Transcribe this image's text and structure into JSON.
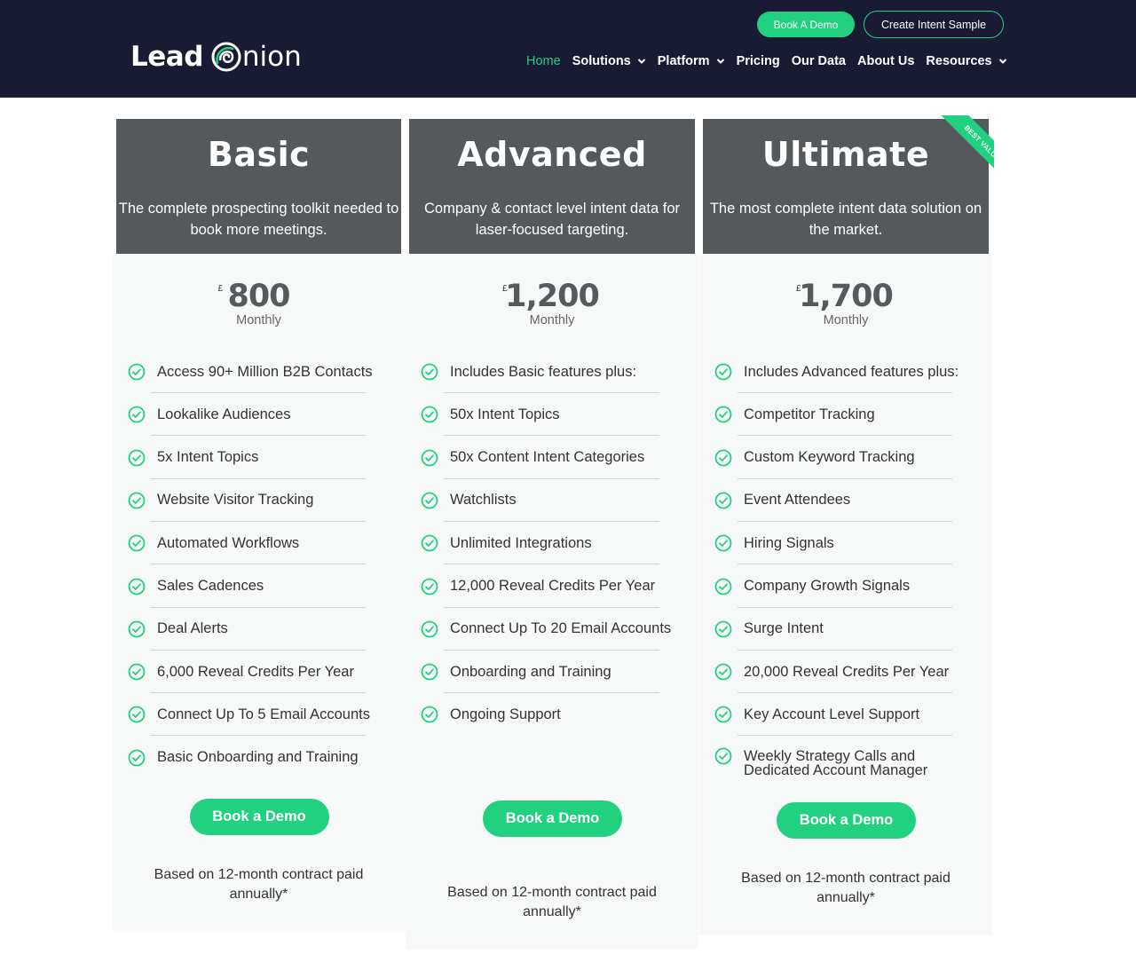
{
  "header": {
    "logo": {
      "part1": "Lead",
      "part2": "nion"
    },
    "book_demo": "Book A Demo",
    "create_sample": "Create Intent Sample",
    "nav": [
      {
        "label": "Home",
        "active": true,
        "dropdown": false
      },
      {
        "label": "Solutions",
        "active": false,
        "dropdown": true
      },
      {
        "label": "Platform",
        "active": false,
        "dropdown": true
      },
      {
        "label": "Pricing",
        "active": false,
        "dropdown": false
      },
      {
        "label": "Our Data",
        "active": false,
        "dropdown": false
      },
      {
        "label": "About Us",
        "active": false,
        "dropdown": false
      },
      {
        "label": "Resources",
        "active": false,
        "dropdown": true
      }
    ]
  },
  "colors": {
    "accent": "#22d17f",
    "header_bg": "#191a33",
    "plan_head_bg": "#55595c"
  },
  "plans": [
    {
      "name": "Basic",
      "description": "The complete prospecting toolkit needed to book more meetings.",
      "currency": "£",
      "price": "800",
      "period": "Monthly",
      "features": [
        "Access 90+ Million B2B Contacts",
        "Lookalike Audiences",
        "5x Intent Topics",
        "Website Visitor Tracking",
        "Automated Workflows",
        "Sales Cadences",
        "Deal Alerts",
        "6,000 Reveal Credits Per Year",
        "Connect Up To 5 Email Accounts",
        "Basic Onboarding and Training"
      ],
      "cta": "Book a Demo",
      "note": "Based on 12-month contract paid annually*"
    },
    {
      "name": "Advanced",
      "description": "Company & contact level intent data for laser-focused targeting.",
      "currency": "£",
      "price": "1,200",
      "period": "Monthly",
      "features": [
        "Includes Basic features plus:",
        "50x Intent Topics",
        "50x Content Intent Categories",
        "Watchlists",
        "Unlimited Integrations",
        "12,000 Reveal Credits Per Year",
        "Connect Up To 20 Email Accounts",
        "Onboarding and Training",
        "Ongoing Support"
      ],
      "cta": "Book a Demo",
      "note": "Based on 12-month contract paid annually*"
    },
    {
      "name": "Ultimate",
      "description": "The most complete intent data solution on the market.",
      "currency": "£",
      "price": "1,700",
      "period": "Monthly",
      "badge": "BEST VALUE",
      "features": [
        "Includes Advanced features plus:",
        "Competitor Tracking",
        "Custom Keyword Tracking",
        "Event Attendees",
        "Hiring Signals",
        "Company Growth Signals",
        "Surge Intent",
        "20,000 Reveal Credits Per Year",
        "Key Account Level Support",
        "Weekly Strategy Calls and Dedicated Account Manager"
      ],
      "cta": "Book a Demo",
      "note": "Based on 12-month contract paid annually*"
    }
  ]
}
